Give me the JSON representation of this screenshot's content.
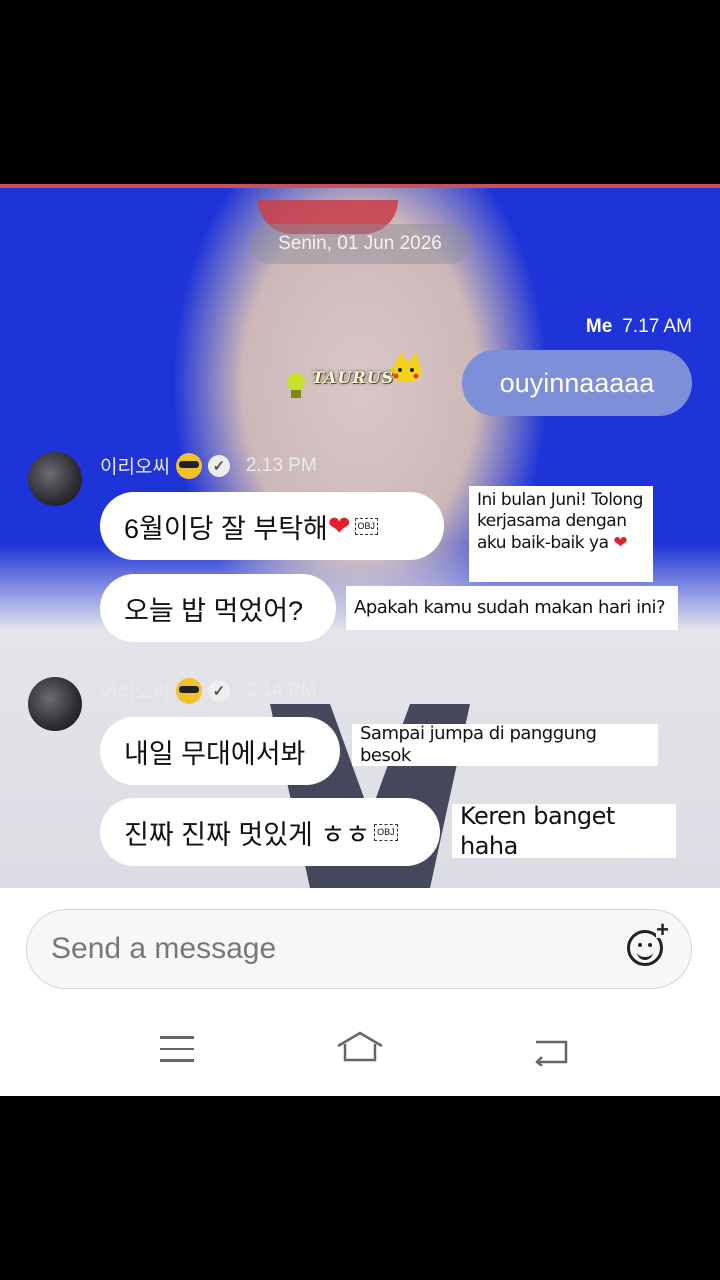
{
  "chat": {
    "date": "Senin, 01 Jun 2026",
    "me": {
      "label": "Me",
      "time": "7.17 AM",
      "message": "ouyinnaaaaa"
    },
    "sticker_text": "TAURUS",
    "groups": [
      {
        "sender": "이리오씨",
        "time": "2.13 PM",
        "messages": [
          {
            "text": "6월이당  잘 부탁해",
            "obj": "OBJ",
            "translation": "Ini bulan Juni! Tolong kerjasama dengan aku baik-baik ya"
          },
          {
            "text": "오늘 밥 먹었어?",
            "translation": "Apakah kamu sudah makan hari ini?"
          }
        ]
      },
      {
        "sender": "이리오씨",
        "time": "2.14 PM",
        "messages": [
          {
            "text": "내일 무대에서봐",
            "translation": "Sampai jumpa di panggung besok"
          },
          {
            "text": "진짜 진짜 멋있게 ㅎㅎ",
            "obj": "OBJ",
            "translation": "Keren banget haha"
          }
        ]
      }
    ]
  },
  "composer": {
    "placeholder": "Send a message",
    "icon": "emoji-add-icon"
  },
  "navbar": {
    "icons": [
      "menu-icon",
      "home-icon",
      "back-icon"
    ]
  },
  "colors": {
    "background": "#1e34d8",
    "me_bubble": "#7d8fd9",
    "accent_line": "#c4525f"
  }
}
